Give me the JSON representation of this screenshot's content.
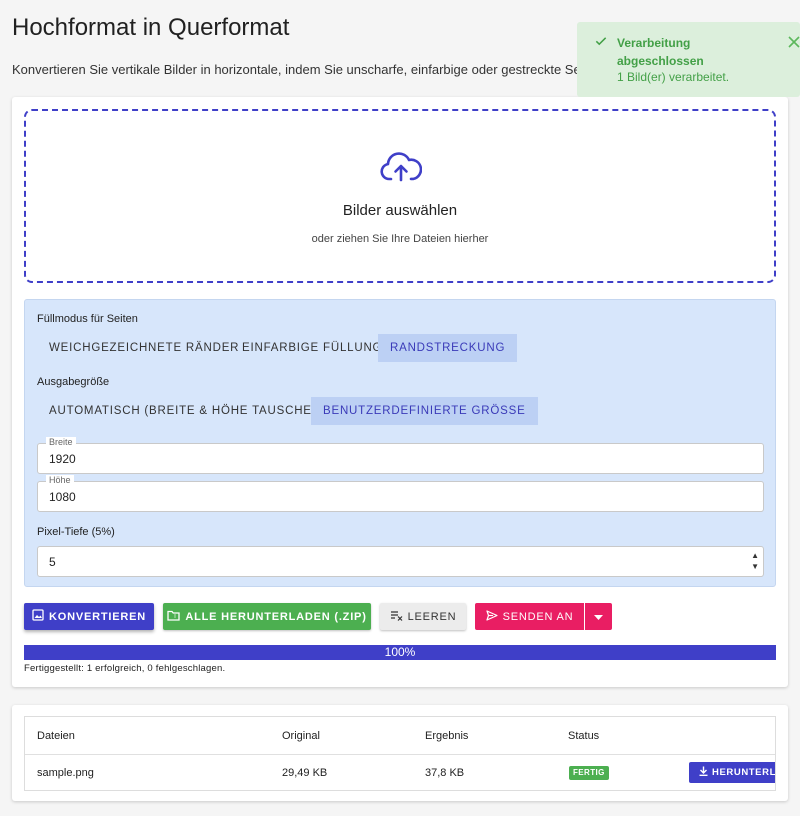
{
  "page": {
    "title": "Hochformat in Querformat",
    "subtitle": "Konvertieren Sie vertikale Bilder in horizontale, indem Sie unscharfe, einfarbige oder gestreckte Seiten"
  },
  "toast": {
    "title": "Verarbeitung abgeschlossen",
    "message": "1 Bild(er) verarbeitet.",
    "color": "#43a047",
    "icon": "check-icon"
  },
  "dropzone": {
    "icon": "cloud-upload-icon",
    "title": "Bilder auswählen",
    "subtitle": "oder ziehen Sie Ihre Dateien hierher"
  },
  "settings": {
    "fill_mode_label": "Füllmodus für Seiten",
    "fill_modes": [
      "WEICHGEZEICHNETE RÄNDER",
      "EINFARBIGE FÜLLUNG",
      "RANDSTRECKUNG"
    ],
    "fill_mode_selected": "RANDSTRECKUNG",
    "output_size_label": "Ausgabegröße",
    "output_sizes": [
      "AUTOMATISCH (BREITE & HÖHE TAUSCHEN)",
      "BENUTZERDEFINIERTE GRÖSSE"
    ],
    "output_size_selected": "BENUTZERDEFINIERTE GRÖSSE",
    "width_label": "Breite",
    "width_value": "1920",
    "height_label": "Höhe",
    "height_value": "1080",
    "pixel_depth_label": "Pixel-Tiefe (5%)",
    "pixel_depth_value": "5"
  },
  "actions": {
    "convert": "KONVERTIEREN",
    "download_all": "ALLE HERUNTERLADEN (.ZIP)",
    "clear": "LEEREN",
    "send_to": "SENDEN AN"
  },
  "progress": {
    "percent": 100,
    "label": "100%",
    "summary": "Fertiggestellt: 1 erfolgreich, 0 fehlgeschlagen."
  },
  "table": {
    "headers": [
      "Dateien",
      "Original",
      "Ergebnis",
      "Status"
    ],
    "rows": [
      {
        "file": "sample.png",
        "original": "29,49 KB",
        "result": "37,8 KB",
        "status": "FERTIG",
        "action": "HERUNTERLADEN"
      }
    ]
  },
  "colors": {
    "primary": "#3f3fc8",
    "success": "#4caf50",
    "send": "#e91e63",
    "settings_bg": "#d7e6fb"
  }
}
